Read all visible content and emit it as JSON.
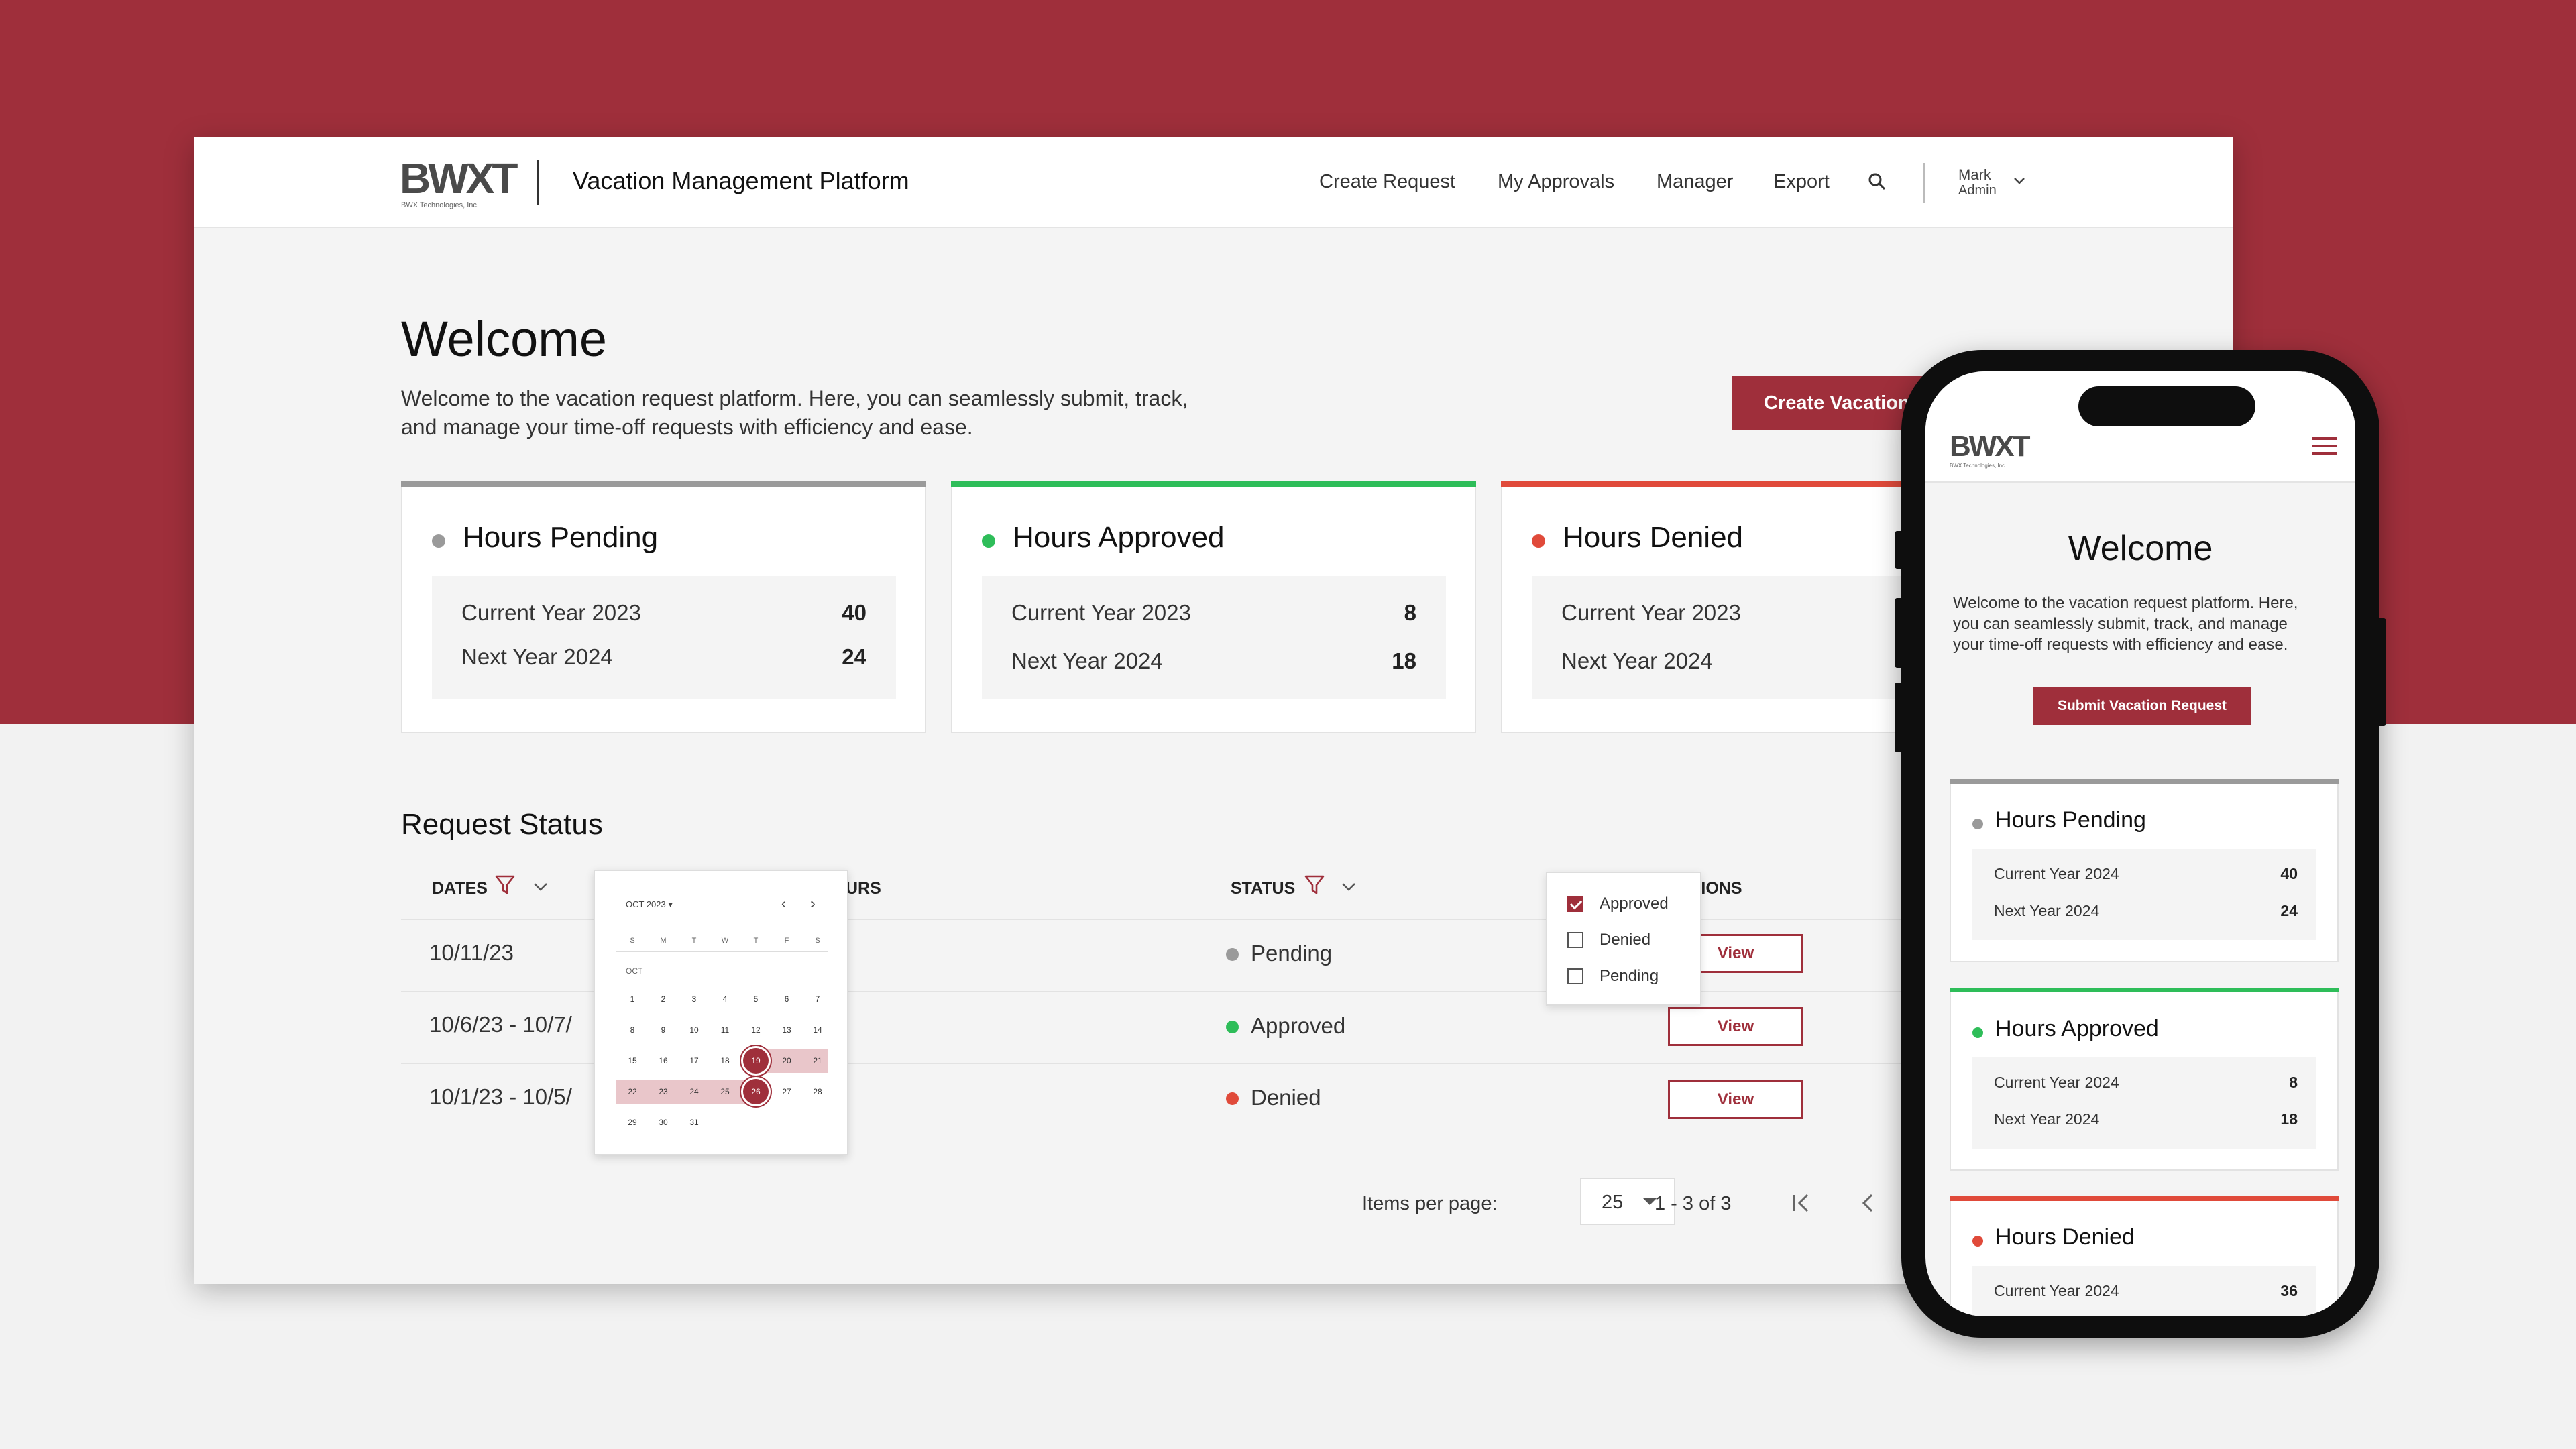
{
  "brand": {
    "logo_text": "BWXT",
    "logo_sub": "BWX Technologies, Inc.",
    "app_title": "Vacation Management Platform",
    "accent": "#9f2f3b"
  },
  "nav": {
    "items": [
      "Create Request",
      "My Approvals",
      "Manager",
      "Export"
    ],
    "user_name": "Mark",
    "user_role": "Admin"
  },
  "welcome": {
    "title": "Welcome",
    "text_line1": "Welcome to the vacation request platform. Here, you can seamlessly submit, track,",
    "text_line2": "and manage your time-off requests with efficiency and ease.",
    "button": "Create Vacation Request"
  },
  "cards": [
    {
      "title": "Hours Pending",
      "color": "#9a9a9a",
      "rows": [
        {
          "label": "Current Year 2023",
          "value": "40"
        },
        {
          "label": "Next Year 2024",
          "value": "24"
        }
      ]
    },
    {
      "title": "Hours Approved",
      "color": "#2ebd59",
      "rows": [
        {
          "label": "Current Year 2023",
          "value": "8"
        },
        {
          "label": "Next Year 2024",
          "value": "18"
        }
      ]
    },
    {
      "title": "Hours Denied",
      "color": "#e04a3a",
      "rows": [
        {
          "label": "Current Year 2023",
          "value": ""
        },
        {
          "label": "Next Year 2024",
          "value": ""
        }
      ]
    }
  ],
  "request_status": {
    "title": "Request Status",
    "columns": {
      "dates": "DATES",
      "hours": "URS",
      "status": "STATUS",
      "actions": "ACTIONS"
    },
    "rows": [
      {
        "dates": "10/11/23",
        "status": "Pending",
        "action": "View"
      },
      {
        "dates": "10/6/23 - 10/7/",
        "status": "Approved",
        "action": "View"
      },
      {
        "dates": "10/1/23 - 10/5/",
        "status": "Denied",
        "action": "View"
      }
    ]
  },
  "calendar": {
    "month_label": "OCT 2023 ▾",
    "prev": "‹",
    "next": "›",
    "weekdays": [
      "S",
      "M",
      "T",
      "W",
      "T",
      "F",
      "S"
    ],
    "month_short": "OCT",
    "days": [
      [
        "1",
        "2",
        "3",
        "4",
        "5",
        "6",
        "7"
      ],
      [
        "8",
        "9",
        "10",
        "11",
        "12",
        "13",
        "14"
      ],
      [
        "15",
        "16",
        "17",
        "18",
        "19",
        "20",
        "21"
      ],
      [
        "22",
        "23",
        "24",
        "25",
        "26",
        "27",
        "28"
      ],
      [
        "29",
        "30",
        "31"
      ]
    ],
    "range_start": "19",
    "range_end": "26"
  },
  "status_filter": {
    "options": [
      {
        "label": "Approved",
        "checked": true
      },
      {
        "label": "Denied",
        "checked": false
      },
      {
        "label": "Pending",
        "checked": false
      }
    ]
  },
  "pagination": {
    "items_per_page_label": "Items per page:",
    "items_per_page": "25",
    "range": "1 - 3 of 3"
  },
  "mobile": {
    "welcome_title": "Welcome",
    "text_line1": "Welcome to the vacation request platform. Here,",
    "text_line2": "you can seamlessly submit, track, and manage",
    "text_line3": "your time-off requests with efficiency and ease.",
    "button": "Submit Vacation Request",
    "cards": [
      {
        "title": "Hours Pending",
        "rows": [
          {
            "label": "Current Year 2024",
            "value": "40"
          },
          {
            "label": "Next Year 2024",
            "value": "24"
          }
        ]
      },
      {
        "title": "Hours Approved",
        "rows": [
          {
            "label": "Current Year 2024",
            "value": "8"
          },
          {
            "label": "Next Year 2024",
            "value": "18"
          }
        ]
      },
      {
        "title": "Hours Denied",
        "rows": [
          {
            "label": "Current Year 2024",
            "value": "36"
          }
        ]
      }
    ]
  }
}
